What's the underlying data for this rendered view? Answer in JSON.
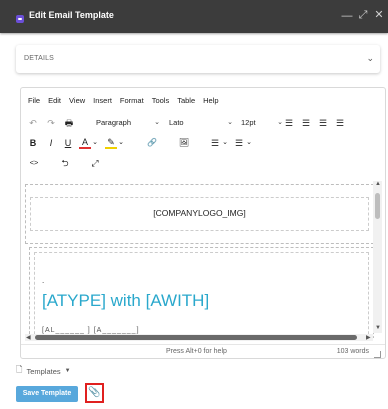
{
  "window": {
    "title": "Edit Email Template",
    "minimize_glyph": "—",
    "maximize_glyph": "⤢",
    "close_glyph": "✕"
  },
  "details": {
    "label": "DETAILS",
    "chevron": "⌄"
  },
  "editor": {
    "menu": [
      "File",
      "Edit",
      "View",
      "Insert",
      "Format",
      "Tools",
      "Table",
      "Help"
    ],
    "toolbar": {
      "undo": "↶",
      "redo": "↷",
      "print": "🖶",
      "block_format": "Paragraph",
      "font_family": "Lato",
      "font_size": "12pt",
      "bold": "B",
      "italic": "I",
      "underline": "U",
      "text_color": "A",
      "highlight": "✎",
      "link": "🔗",
      "image": "🖼",
      "bullets": "☰",
      "numbers": "☰",
      "align_left": "☰",
      "align_center": "☰",
      "align_right": "☰",
      "justify": "☰",
      "code": "<>",
      "rtl": "⮌",
      "fullscreen": "⤢"
    },
    "content": {
      "logo_placeholder": "[COMPANYLOGO_IMG]",
      "bullet": ".",
      "heading": "[ATYPE] with [AWITH]",
      "partial_line": "[AL______ ] [A_______]"
    },
    "status": {
      "help": "Press Alt+0 for help",
      "word_count": "103 words"
    }
  },
  "footer": {
    "templates_label": "Templates",
    "save_label": "Save Template",
    "attach_icon": "📎"
  },
  "colors": {
    "titlebar": "#3c3c3c",
    "accent": "#58a8dc",
    "heading": "#2aa8cc",
    "highlight_border": "#e0201f"
  }
}
